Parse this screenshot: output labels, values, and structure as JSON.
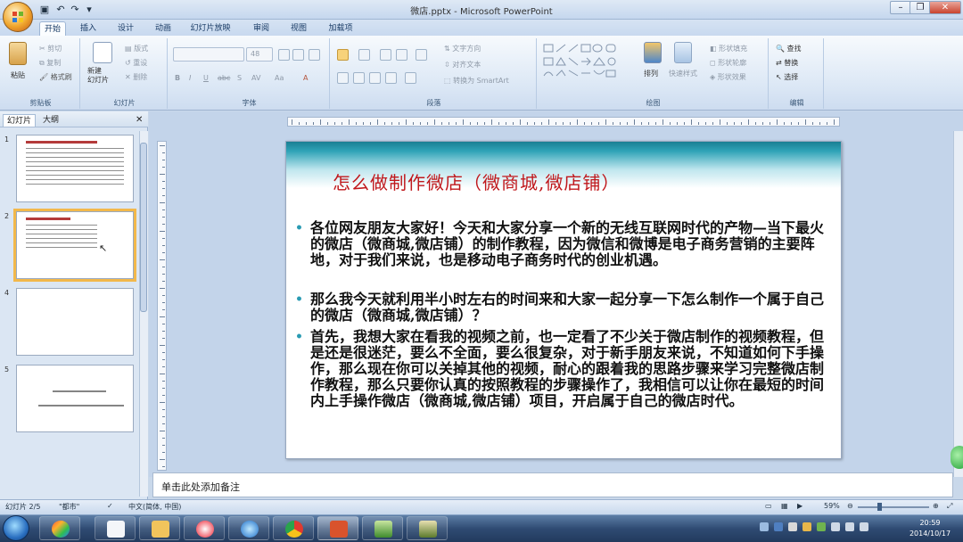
{
  "window": {
    "title": "微店.pptx - Microsoft PowerPoint"
  },
  "tabs": [
    {
      "label": "开始",
      "active": true
    },
    {
      "label": "插入"
    },
    {
      "label": "设计"
    },
    {
      "label": "动画"
    },
    {
      "label": "幻灯片放映"
    },
    {
      "label": "审阅"
    },
    {
      "label": "视图"
    },
    {
      "label": "加载项"
    }
  ],
  "ribbon": {
    "clipboard": {
      "label": "剪贴板",
      "paste": "粘贴",
      "cut": "剪切",
      "copy": "复制",
      "format_painter": "格式刷"
    },
    "slides": {
      "label": "幻灯片",
      "new_slide": "新建\n幻灯片",
      "layout": "版式",
      "reset": "重设",
      "delete": "删除"
    },
    "font": {
      "label": "字体",
      "size": "48"
    },
    "paragraph": {
      "label": "段落",
      "text_direction": "文字方向",
      "align_text": "对齐文本",
      "smartart": "转换为 SmartArt"
    },
    "drawing": {
      "label": "绘图",
      "arrange": "排列",
      "quick_styles": "快速样式",
      "shape_fill": "形状填充",
      "shape_outline": "形状轮廓",
      "shape_effects": "形状效果"
    },
    "editing": {
      "label": "编辑",
      "find": "查找",
      "replace": "替换",
      "select": "选择"
    }
  },
  "pane": {
    "tab_slides": "幻灯片",
    "tab_outline": "大纲"
  },
  "thumbnails": [
    {
      "num": "1"
    },
    {
      "num": "2"
    },
    {
      "num": "4"
    },
    {
      "num": "5"
    }
  ],
  "slide": {
    "title": "怎么做制作微店（微商城,微店铺）",
    "bullets": [
      "各位网友朋友大家好！今天和大家分享一个新的无线互联网时代的产物—当下最火的微店（微商城,微店铺）的制作教程，因为微信和微博是电子商务营销的主要阵地，对于我们来说，也是移动电子商务时代的创业机遇。",
      "那么我今天就利用半小时左右的时间来和大家一起分享一下怎么制作一个属于自己的微店（微商城,微店铺）？",
      "首先，我想大家在看我的视频之前，也一定看了不少关于微店制作的视频教程，但是还是很迷茫，要么不全面，要么很复杂，对于新手朋友来说，不知道如何下手操作，那么现在你可以关掉其他的视频，耐心的跟着我的思路步骤来学习完整微店制作教程，那么只要你认真的按照教程的步骤操作了，我相信可以让你在最短的时间内上手操作微店（微商城,微店铺）项目，开启属于自己的微店时代。"
    ]
  },
  "notes": {
    "placeholder": "单击此处添加备注"
  },
  "status": {
    "slide_info": "幻灯片 2/5",
    "theme": "\"都市\"",
    "language": "中文(简体, 中国)",
    "zoom": "59%"
  },
  "taskbar": {
    "time": "20:59",
    "date": "2014/10/17"
  }
}
